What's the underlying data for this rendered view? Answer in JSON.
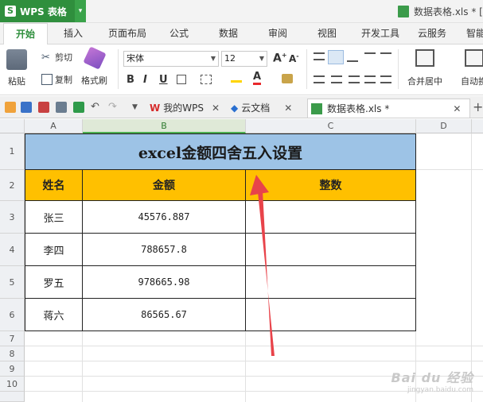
{
  "app": {
    "name": "WPS 表格",
    "logo_letter": "S",
    "dropdown_glyph": "▾",
    "document_title": "数据表格.xls * ["
  },
  "menu": {
    "tabs": [
      "开始",
      "插入",
      "页面布局",
      "公式",
      "数据",
      "审阅",
      "视图",
      "开发工具",
      "云服务",
      "智能"
    ]
  },
  "ribbon": {
    "paste": "粘贴",
    "cut": "剪切",
    "copy": "复制",
    "format_painter": "格式刷",
    "font_name": "宋体",
    "font_size": "12",
    "bold": "B",
    "italic": "I",
    "underline": "U",
    "merge_center": "合并居中",
    "auto_wrap": "自动换"
  },
  "doc_tabs": [
    {
      "label": "我的WPS"
    },
    {
      "label": "云文档"
    },
    {
      "label": "数据表格.xls *"
    }
  ],
  "sheet": {
    "columns": [
      "A",
      "B",
      "C",
      "D"
    ],
    "rows": [
      "1",
      "2",
      "3",
      "4",
      "5",
      "6",
      "7",
      "8",
      "9",
      "10"
    ],
    "title": "excel金额四舍五入设置",
    "headers": {
      "name": "姓名",
      "amount": "金额",
      "integer": "整数"
    },
    "data": [
      {
        "name": "张三",
        "amount": "45576.887",
        "integer": ""
      },
      {
        "name": "李四",
        "amount": "788657.8",
        "integer": ""
      },
      {
        "name": "罗五",
        "amount": "978665.98",
        "integer": ""
      },
      {
        "name": "蒋六",
        "amount": "86565.67",
        "integer": ""
      }
    ]
  },
  "watermark": {
    "line1": "Bai du 经验",
    "line2": "jingyan.baidu.com"
  },
  "colors": {
    "accent": "#2f8f3d",
    "title_fill": "#9dc3e6",
    "header_fill": "#ffc000",
    "arrow": "#e8434a"
  }
}
